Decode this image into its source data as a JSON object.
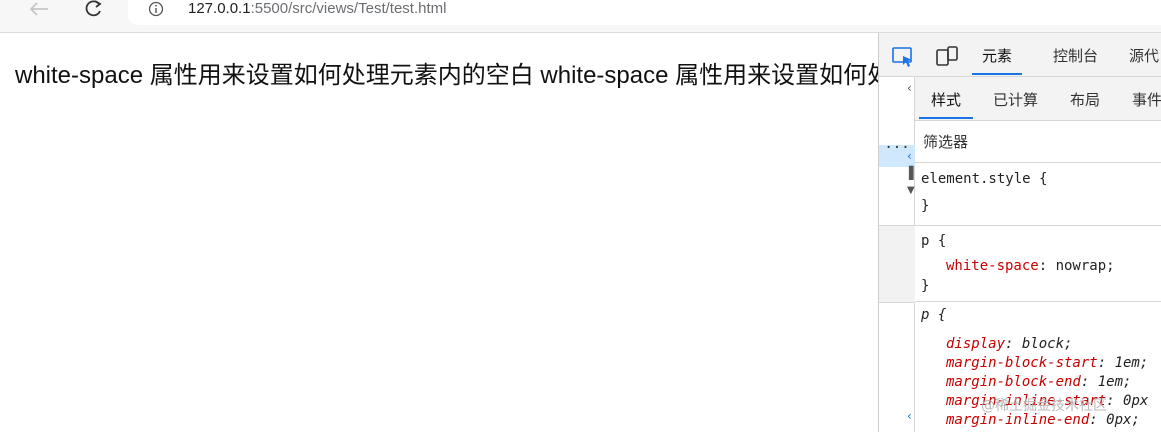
{
  "browser": {
    "url_host": "127.0.0.1",
    "url_path": ":5500/src/views/Test/test.html"
  },
  "page": {
    "demo_text": "white-space 属性用来设置如何处理元素内的空白 white-space 属性用来设置如何处理元素内的空白"
  },
  "devtools": {
    "tabs": [
      "元素",
      "控制台",
      "源代"
    ],
    "active_tab": "元素",
    "sub_tabs": [
      "样式",
      "已计算",
      "布局",
      "事件"
    ],
    "active_sub_tab": "样式",
    "filter_placeholder": "筛选器",
    "ellipsis": "...",
    "rules": {
      "element_style": {
        "selector_open": "element.style {",
        "close": "}"
      },
      "author_p": {
        "selector_open": "p {",
        "prop": "white-space",
        "value": "nowrap;",
        "close": "}"
      },
      "ua_p": {
        "selector_open": "p {",
        "decls": [
          {
            "prop": "display",
            "value": "block;"
          },
          {
            "prop": "margin-block-start",
            "value": "1em;"
          },
          {
            "prop": "margin-block-end",
            "value": "1em;"
          },
          {
            "prop": "margin-inline-start",
            "value": "0px"
          },
          {
            "prop": "margin-inline-end",
            "value": "0px;"
          }
        ]
      }
    }
  },
  "watermark": "@稀土掘金技术社区",
  "colors": {
    "active_tab_underline": "#1a73e8",
    "selected_row": "#cfe8fc",
    "css_property": "#c80000"
  }
}
